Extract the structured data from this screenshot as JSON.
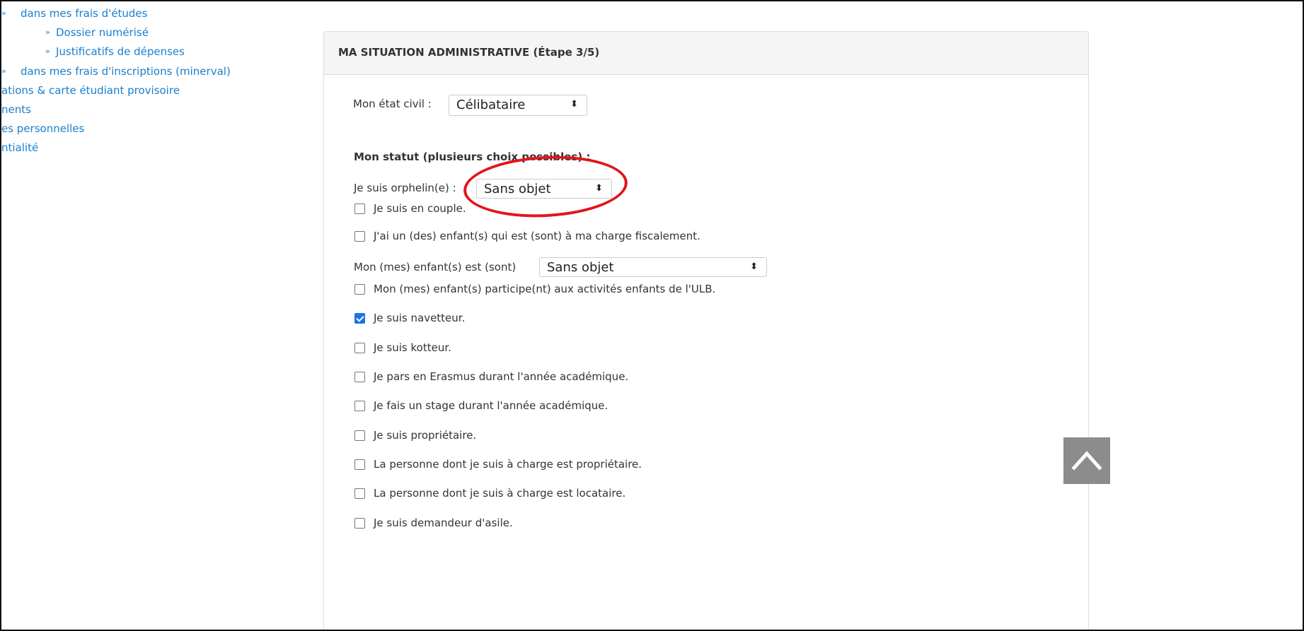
{
  "sidebar": {
    "items": [
      {
        "label": "dans mes frais d'études"
      },
      {
        "label": "Dossier numérisé"
      },
      {
        "label": "Justificatifs de dépenses"
      },
      {
        "label": "dans mes frais d'inscriptions (minerval)"
      },
      {
        "label": "ations & carte étudiant provisoire"
      },
      {
        "label": "nents"
      },
      {
        "label": "es personnelles"
      },
      {
        "label": "ntialité"
      }
    ],
    "arrow_glyph": "»"
  },
  "panel": {
    "title": "MA SITUATION ADMINISTRATIVE (Étape 3/5)"
  },
  "form": {
    "civil_state": {
      "label": "Mon état civil :",
      "value": "Célibataire"
    },
    "status_heading": "Mon statut (plusieurs choix possibles) :",
    "orphan": {
      "label": "Je suis orphelin(e) :",
      "value": "Sans objet"
    },
    "children_select": {
      "label": "Mon (mes) enfant(s) est (sont)",
      "value": "Sans objet"
    },
    "checkboxes": [
      {
        "label": "Je suis en couple.",
        "checked": false
      },
      {
        "label": "J'ai un (des) enfant(s) qui est (sont) à ma charge fiscalement.",
        "checked": false
      },
      {
        "label": "Mon (mes) enfant(s) participe(nt) aux activités enfants de l'ULB.",
        "checked": false
      },
      {
        "label": "Je suis navetteur.",
        "checked": true
      },
      {
        "label": "Je suis kotteur.",
        "checked": false
      },
      {
        "label": "Je pars en Erasmus durant l'année académique.",
        "checked": false
      },
      {
        "label": "Je fais un stage durant l'année académique.",
        "checked": false
      },
      {
        "label": "Je suis propriétaire.",
        "checked": false
      },
      {
        "label": "La personne dont je suis à charge est propriétaire.",
        "checked": false
      },
      {
        "label": "La personne dont je suis à charge est locataire.",
        "checked": false
      },
      {
        "label": "Je suis demandeur d'asile.",
        "checked": false
      }
    ]
  },
  "select_caret_glyph": "⬍",
  "icons": {
    "scroll_top": "chevron-up-icon",
    "annotation": "red-ellipse-annotation"
  },
  "colors": {
    "link": "#1a7fcb",
    "annotation": "#e3141c",
    "checkbox_checked": "#1a73e8",
    "scroll_button": "#8c8c8c"
  }
}
